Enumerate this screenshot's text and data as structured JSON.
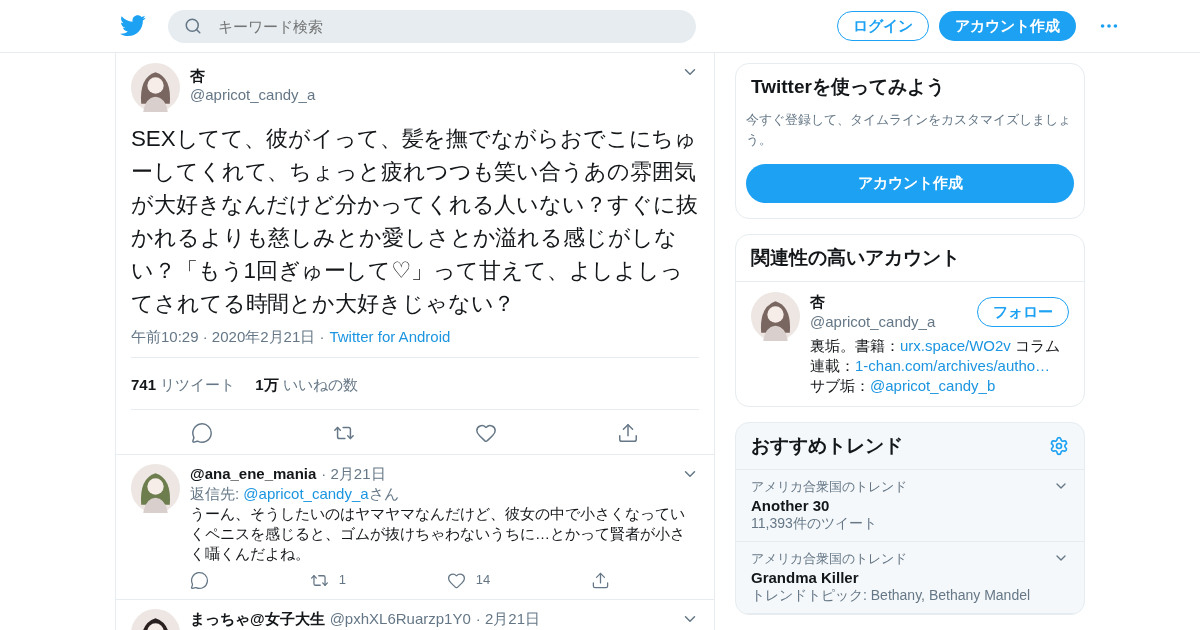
{
  "header": {
    "search_placeholder": "キーワード検索",
    "login": "ログイン",
    "signup": "アカウント作成"
  },
  "tweet": {
    "name": "杏",
    "handle": "@apricot_candy_a",
    "text": "SEXしてて、彼がイって、髪を撫でながらおでこにちゅーしてくれて、ちょっと疲れつつも笑い合うあの雰囲気が大好きなんだけど分かってくれる人いない？すぐに抜かれるよりも慈しみとか愛しさとか溢れる感じがしない？「もう1回ぎゅーして♡」って甘えて、よしよしってされてる時間とか大好きじゃない？",
    "time": "午前10:29 · 2020年2月21日 ·",
    "source": "Twitter for Android",
    "retweets_count": "741",
    "retweets_label": "リツイート",
    "likes_count": "1万",
    "likes_label": "いいねの数"
  },
  "replies": [
    {
      "name": "@ana_ene_mania",
      "date": "· 2月21日",
      "reply_to_label": "返信先: ",
      "reply_to_handle": "@apricot_candy_a",
      "reply_to_suffix": "さん",
      "text": "うーん、そうしたいのはヤマヤマなんだけど、彼女の中で小さくなっていくペニスを感じると、ゴムが抜けちゃわないうちに…とかって賢者が小さく囁くんだよね。",
      "retweets": "1",
      "likes": "14"
    },
    {
      "name": "まっちゃ@女子大生",
      "handle": "@pxhXL6Ruarzp1Y0",
      "date": "· 2月21日"
    }
  ],
  "sidebar": {
    "signup_card": {
      "title": "Twitterを使ってみよう",
      "text": "今すぐ登録して、タイムラインをカスタマイズしましょう。",
      "button": "アカウント作成"
    },
    "related": {
      "title": "関連性の高いアカウント",
      "accounts": [
        {
          "name": "杏",
          "handle": "@apricot_candy_a",
          "follow": "フォロー",
          "bio": [
            {
              "kind": "text",
              "text": "裏垢。書籍："
            },
            {
              "kind": "link",
              "text": "urx.space/WO2v"
            },
            {
              "kind": "text",
              "text": " コラム連載："
            },
            {
              "kind": "link",
              "text": "1-chan.com/archives/autho…"
            },
            {
              "kind": "text",
              "text": " サブ垢："
            },
            {
              "kind": "link",
              "text": "@apricot_candy_b"
            }
          ]
        }
      ]
    },
    "trends": {
      "title": "おすすめトレンド",
      "items": [
        {
          "context": "アメリカ合衆国のトレンド",
          "name": "Another 30",
          "meta": "11,393件のツイート"
        },
        {
          "context": "アメリカ合衆国のトレンド",
          "name": "Grandma Killer",
          "meta": "トレンドトピック: Bethany, Bethany Mandel"
        }
      ]
    }
  }
}
